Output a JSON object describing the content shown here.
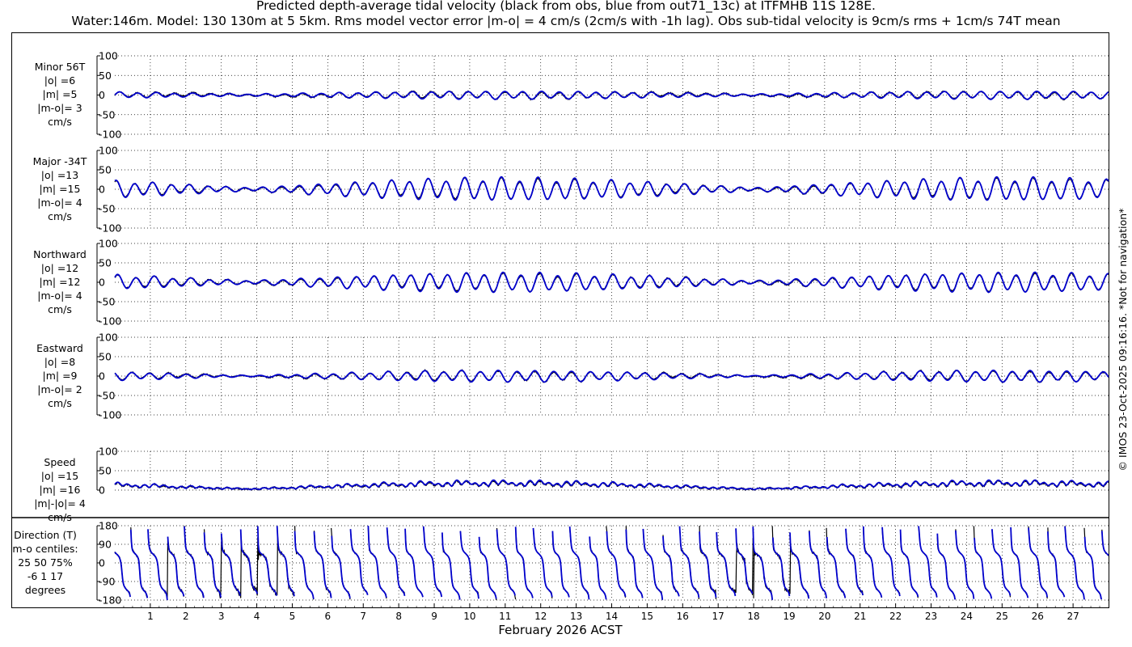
{
  "title_line1": "Predicted depth-average tidal velocity (black from obs, blue from out71_13c) at ITFMHB 11S 128E.",
  "title_line2": "Water:146m. Model: 130 130m at 5 5km. Rms model vector error |m-o| = 4 cm/s (2cm/s with -1h lag). Obs sub-tidal velocity is 9cm/s rms + 1cm/s 74T mean",
  "side_note": "© IMOS 23-Oct-2025 09:16:16. *Not for navigation*",
  "colors": {
    "obs": "#000000",
    "model": "#0000cc",
    "grid": "#000000"
  },
  "chart_data": {
    "type": "line",
    "xlabel": "February 2026 ACST",
    "x_ticks": [
      "1",
      "2",
      "3",
      "4",
      "5",
      "6",
      "7",
      "8",
      "9",
      "10",
      "11",
      "12",
      "13",
      "14",
      "15",
      "16",
      "17",
      "18",
      "19",
      "20",
      "21",
      "22",
      "23",
      "24",
      "25",
      "26",
      "27"
    ],
    "xlim": [
      0.0,
      28.0
    ],
    "grid": true,
    "series": [
      {
        "name": "obs",
        "color": "#000000"
      },
      {
        "name": "out71_13c",
        "color": "#0000cc"
      }
    ],
    "panels": [
      {
        "id": "minor",
        "label": [
          "Minor 56T",
          "|o| =6",
          "|m| =5",
          "|m-o|= 3",
          "cm/s"
        ],
        "ylim": [
          -100,
          100
        ],
        "yticks": [
          "100",
          "50",
          "0",
          "-50",
          "-100"
        ],
        "yvals": [
          100,
          50,
          0,
          -50,
          -100
        ],
        "line": "top",
        "amplitude_range": [
          3,
          11
        ],
        "obs_rms": 6,
        "model_rms": 5
      },
      {
        "id": "major",
        "label": [
          "Major -34T",
          "|o| =13",
          "|m| =15",
          "|m-o|= 4",
          "cm/s"
        ],
        "ylim": [
          -100,
          100
        ],
        "yticks": [
          "100",
          "50",
          "0",
          "-50",
          "-100"
        ],
        "yvals": [
          100,
          50,
          0,
          -50,
          -100
        ],
        "line": "top",
        "amplitude_range": [
          5,
          32
        ],
        "obs_rms": 13,
        "model_rms": 15
      },
      {
        "id": "north",
        "label": [
          "Northward",
          "|o| =12",
          "|m| =12",
          "|m-o|= 4",
          "cm/s"
        ],
        "ylim": [
          -100,
          100
        ],
        "yticks": [
          "100",
          "50",
          "0",
          "-50",
          "-100"
        ],
        "yvals": [
          100,
          50,
          0,
          -50,
          -100
        ],
        "line": "top",
        "amplitude_range": [
          5,
          27
        ],
        "obs_rms": 12,
        "model_rms": 12
      },
      {
        "id": "east",
        "label": [
          "Eastward",
          "|o| =8",
          "|m| =9",
          "|m-o|= 2",
          "cm/s"
        ],
        "ylim": [
          -100,
          100
        ],
        "yticks": [
          "100",
          "50",
          "0",
          "-50",
          "-100"
        ],
        "yvals": [
          100,
          50,
          0,
          -50,
          -100
        ],
        "line": "top",
        "amplitude_range": [
          2,
          16
        ],
        "obs_rms": 8,
        "model_rms": 9
      },
      {
        "id": "speed",
        "label": [
          "Speed",
          "|o| =15",
          "|m| =16",
          "|m|-|o|= 4",
          "cm/s"
        ],
        "ylim": [
          0,
          100
        ],
        "yticks": [
          "100",
          "50",
          "0"
        ],
        "yvals": [
          100,
          50,
          0
        ],
        "line": "top",
        "amplitude_range": [
          5,
          32
        ],
        "obs_rms": 15,
        "model_rms": 16
      },
      {
        "id": "direction",
        "label": [
          "Direction (T)",
          "m-o centiles:",
          "25  50  75%",
          "-6   1  17",
          "degrees"
        ],
        "ylim": [
          -180,
          180
        ],
        "yticks": [
          "180",
          "90",
          "0",
          "-90",
          "-180"
        ],
        "yvals": [
          180,
          90,
          0,
          -90,
          -180
        ],
        "line": "box",
        "kind": "direction"
      }
    ]
  }
}
